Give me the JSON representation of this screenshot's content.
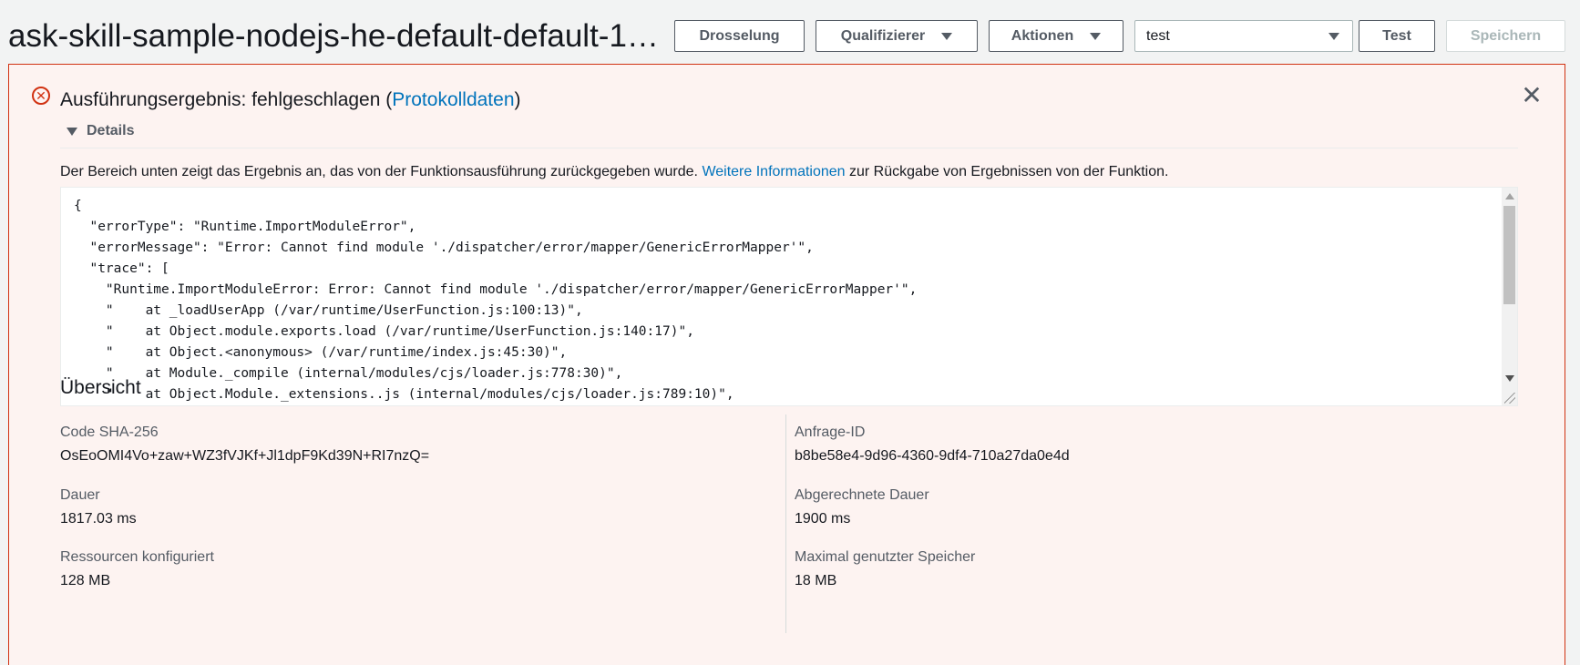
{
  "header": {
    "function_title": "ask-skill-sample-nodejs-he-default-default-1…",
    "buttons": {
      "throttle": "Drosselung",
      "qualifiers": "Qualifizierer",
      "actions": "Aktionen",
      "test": "Test",
      "save": "Speichern"
    },
    "test_event_select": {
      "selected": "test"
    }
  },
  "result": {
    "title_prefix": "Ausführungsergebnis: fehlgeschlagen (",
    "log_link": "Protokolldaten",
    "title_suffix": ")",
    "details_label": "Details",
    "description_prefix": "Der Bereich unten zeigt das Ergebnis an, das von der Funktionsausführung zurückgegeben wurde. ",
    "more_info_link": "Weitere Informationen",
    "description_suffix": " zur Rückgabe von Ergebnissen von der Funktion.",
    "output_text": "{\n  \"errorType\": \"Runtime.ImportModuleError\",\n  \"errorMessage\": \"Error: Cannot find module './dispatcher/error/mapper/GenericErrorMapper'\",\n  \"trace\": [\n    \"Runtime.ImportModuleError: Error: Cannot find module './dispatcher/error/mapper/GenericErrorMapper'\",\n    \"    at _loadUserApp (/var/runtime/UserFunction.js:100:13)\",\n    \"    at Object.module.exports.load (/var/runtime/UserFunction.js:140:17)\",\n    \"    at Object.<anonymous> (/var/runtime/index.js:45:30)\",\n    \"    at Module._compile (internal/modules/cjs/loader.js:778:30)\",\n    \"    at Object.Module._extensions..js (internal/modules/cjs/loader.js:789:10)\","
  },
  "overview": {
    "title": "Übersicht",
    "left": [
      {
        "label": "Code SHA-256",
        "value": "OsEoOMI4Vo+zaw+WZ3fVJKf+Jl1dpF9Kd39N+RI7nzQ="
      },
      {
        "label": "Dauer",
        "value": "1817.03 ms"
      },
      {
        "label": "Ressourcen konfiguriert",
        "value": "128 MB"
      }
    ],
    "right": [
      {
        "label": "Anfrage-ID",
        "value": "b8be58e4-9d96-4360-9df4-710a27da0e4d"
      },
      {
        "label": "Abgerechnete Dauer",
        "value": "1900 ms"
      },
      {
        "label": "Maximal genutzter Speicher",
        "value": "18 MB"
      }
    ]
  },
  "colors": {
    "error": "#d13212",
    "error_bg": "#fdf3f1",
    "link": "#0073bb"
  }
}
